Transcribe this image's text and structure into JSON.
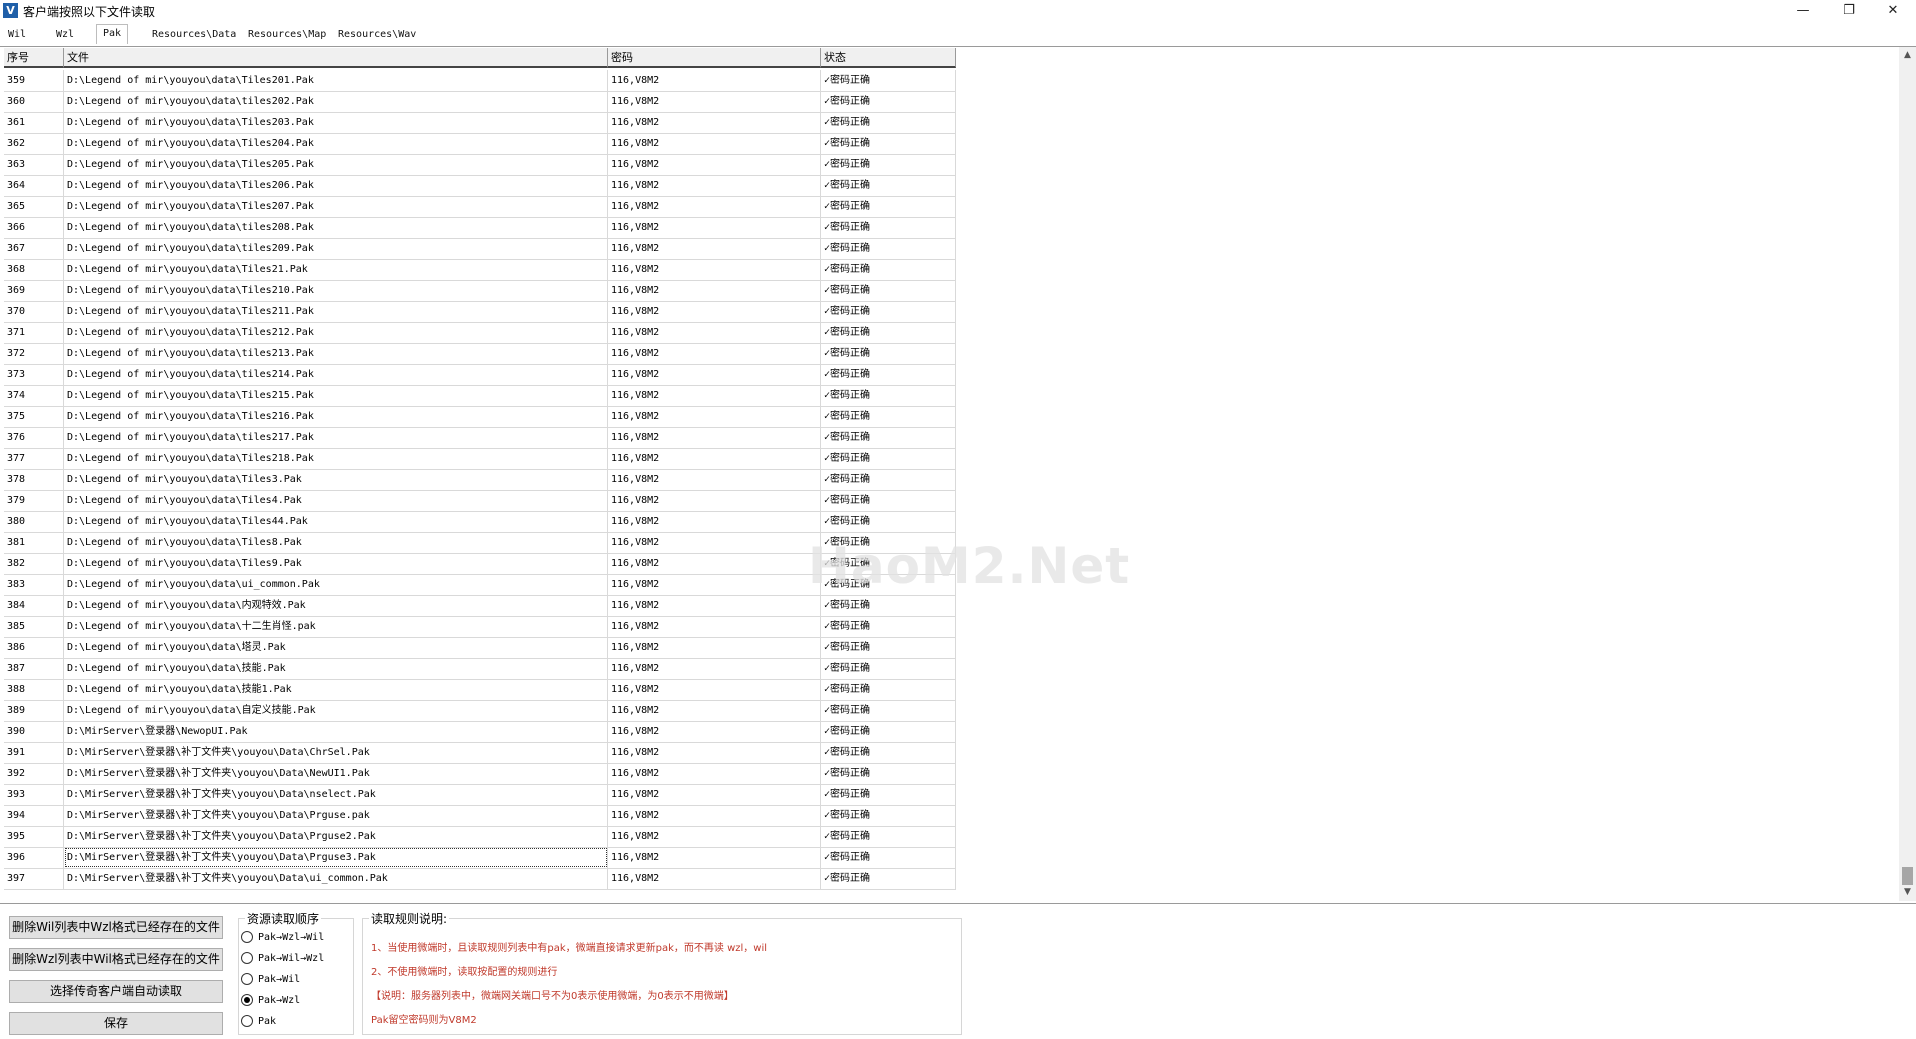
{
  "window": {
    "title": "客户端按照以下文件读取",
    "icon_letter": "V",
    "minimize": "—",
    "restore": "❐",
    "close": "✕"
  },
  "tabs": [
    "Wil",
    "Wzl",
    "Pak",
    "Resources\\Data",
    "Resources\\Map",
    "Resources\\Wav"
  ],
  "active_tab": "Pak",
  "grid": {
    "headers": [
      "序号",
      "文件",
      "密码",
      "状态"
    ],
    "rows": [
      [
        "359",
        "D:\\Legend of mir\\youyou\\data\\Tiles201.Pak",
        "116,V8M2",
        "✓密码正确"
      ],
      [
        "360",
        "D:\\Legend of mir\\youyou\\data\\tiles202.Pak",
        "116,V8M2",
        "✓密码正确"
      ],
      [
        "361",
        "D:\\Legend of mir\\youyou\\data\\Tiles203.Pak",
        "116,V8M2",
        "✓密码正确"
      ],
      [
        "362",
        "D:\\Legend of mir\\youyou\\data\\Tiles204.Pak",
        "116,V8M2",
        "✓密码正确"
      ],
      [
        "363",
        "D:\\Legend of mir\\youyou\\data\\Tiles205.Pak",
        "116,V8M2",
        "✓密码正确"
      ],
      [
        "364",
        "D:\\Legend of mir\\youyou\\data\\Tiles206.Pak",
        "116,V8M2",
        "✓密码正确"
      ],
      [
        "365",
        "D:\\Legend of mir\\youyou\\data\\Tiles207.Pak",
        "116,V8M2",
        "✓密码正确"
      ],
      [
        "366",
        "D:\\Legend of mir\\youyou\\data\\tiles208.Pak",
        "116,V8M2",
        "✓密码正确"
      ],
      [
        "367",
        "D:\\Legend of mir\\youyou\\data\\tiles209.Pak",
        "116,V8M2",
        "✓密码正确"
      ],
      [
        "368",
        "D:\\Legend of mir\\youyou\\data\\Tiles21.Pak",
        "116,V8M2",
        "✓密码正确"
      ],
      [
        "369",
        "D:\\Legend of mir\\youyou\\data\\Tiles210.Pak",
        "116,V8M2",
        "✓密码正确"
      ],
      [
        "370",
        "D:\\Legend of mir\\youyou\\data\\Tiles211.Pak",
        "116,V8M2",
        "✓密码正确"
      ],
      [
        "371",
        "D:\\Legend of mir\\youyou\\data\\Tiles212.Pak",
        "116,V8M2",
        "✓密码正确"
      ],
      [
        "372",
        "D:\\Legend of mir\\youyou\\data\\tiles213.Pak",
        "116,V8M2",
        "✓密码正确"
      ],
      [
        "373",
        "D:\\Legend of mir\\youyou\\data\\tiles214.Pak",
        "116,V8M2",
        "✓密码正确"
      ],
      [
        "374",
        "D:\\Legend of mir\\youyou\\data\\Tiles215.Pak",
        "116,V8M2",
        "✓密码正确"
      ],
      [
        "375",
        "D:\\Legend of mir\\youyou\\data\\Tiles216.Pak",
        "116,V8M2",
        "✓密码正确"
      ],
      [
        "376",
        "D:\\Legend of mir\\youyou\\data\\tiles217.Pak",
        "116,V8M2",
        "✓密码正确"
      ],
      [
        "377",
        "D:\\Legend of mir\\youyou\\data\\Tiles218.Pak",
        "116,V8M2",
        "✓密码正确"
      ],
      [
        "378",
        "D:\\Legend of mir\\youyou\\data\\Tiles3.Pak",
        "116,V8M2",
        "✓密码正确"
      ],
      [
        "379",
        "D:\\Legend of mir\\youyou\\data\\Tiles4.Pak",
        "116,V8M2",
        "✓密码正确"
      ],
      [
        "380",
        "D:\\Legend of mir\\youyou\\data\\Tiles44.Pak",
        "116,V8M2",
        "✓密码正确"
      ],
      [
        "381",
        "D:\\Legend of mir\\youyou\\data\\Tiles8.Pak",
        "116,V8M2",
        "✓密码正确"
      ],
      [
        "382",
        "D:\\Legend of mir\\youyou\\data\\Tiles9.Pak",
        "116,V8M2",
        "✓密码正确"
      ],
      [
        "383",
        "D:\\Legend of mir\\youyou\\data\\ui_common.Pak",
        "116,V8M2",
        "✓密码正确"
      ],
      [
        "384",
        "D:\\Legend of mir\\youyou\\data\\内观特效.Pak",
        "116,V8M2",
        "✓密码正确"
      ],
      [
        "385",
        "D:\\Legend of mir\\youyou\\data\\十二生肖怪.pak",
        "116,V8M2",
        "✓密码正确"
      ],
      [
        "386",
        "D:\\Legend of mir\\youyou\\data\\塔灵.Pak",
        "116,V8M2",
        "✓密码正确"
      ],
      [
        "387",
        "D:\\Legend of mir\\youyou\\data\\技能.Pak",
        "116,V8M2",
        "✓密码正确"
      ],
      [
        "388",
        "D:\\Legend of mir\\youyou\\data\\技能1.Pak",
        "116,V8M2",
        "✓密码正确"
      ],
      [
        "389",
        "D:\\Legend of mir\\youyou\\data\\自定义技能.Pak",
        "116,V8M2",
        "✓密码正确"
      ],
      [
        "390",
        "D:\\MirServer\\登录器\\NewopUI.Pak",
        "116,V8M2",
        "✓密码正确"
      ],
      [
        "391",
        "D:\\MirServer\\登录器\\补丁文件夹\\youyou\\Data\\ChrSel.Pak",
        "116,V8M2",
        "✓密码正确"
      ],
      [
        "392",
        "D:\\MirServer\\登录器\\补丁文件夹\\youyou\\Data\\NewUI1.Pak",
        "116,V8M2",
        "✓密码正确"
      ],
      [
        "393",
        "D:\\MirServer\\登录器\\补丁文件夹\\youyou\\Data\\nselect.Pak",
        "116,V8M2",
        "✓密码正确"
      ],
      [
        "394",
        "D:\\MirServer\\登录器\\补丁文件夹\\youyou\\Data\\Prguse.pak",
        "116,V8M2",
        "✓密码正确"
      ],
      [
        "395",
        "D:\\MirServer\\登录器\\补丁文件夹\\youyou\\Data\\Prguse2.Pak",
        "116,V8M2",
        "✓密码正确"
      ],
      [
        "396",
        "D:\\MirServer\\登录器\\补丁文件夹\\youyou\\Data\\Prguse3.Pak",
        "116,V8M2",
        "✓密码正确"
      ],
      [
        "397",
        "D:\\MirServer\\登录器\\补丁文件夹\\youyou\\Data\\ui_common.Pak",
        "116,V8M2",
        "✓密码正确"
      ]
    ]
  },
  "watermark": "HaoM2.Net",
  "scroll": {
    "up": "▲",
    "down": "▼"
  },
  "buttons": {
    "delete_wil": "删除Wil列表中Wzl格式已经存在的文件",
    "delete_wzl": "删除Wzl列表中Wil格式已经存在的文件",
    "auto_read": "选择传奇客户端自动读取",
    "save": "保存"
  },
  "order_group": {
    "title": "资源读取顺序",
    "options": [
      "Pak→Wzl→Wil",
      "Pak→Wil→Wzl",
      "Pak→Wil",
      "Pak→Wzl",
      "Pak"
    ],
    "selected": "Pak→Wzl"
  },
  "rules_group": {
    "title": "读取规则说明:",
    "lines": [
      "1、当使用微端时，且读取规则列表中有pak，微端直接请求更新pak，而不再读 wzl，wil",
      "2、不使用微端时，读取按配置的规则进行",
      "【说明：服务器列表中，微端网关端口号不为0表示使用微端，为0表示不用微端】",
      "Pak留空密码则为V8M2"
    ]
  }
}
